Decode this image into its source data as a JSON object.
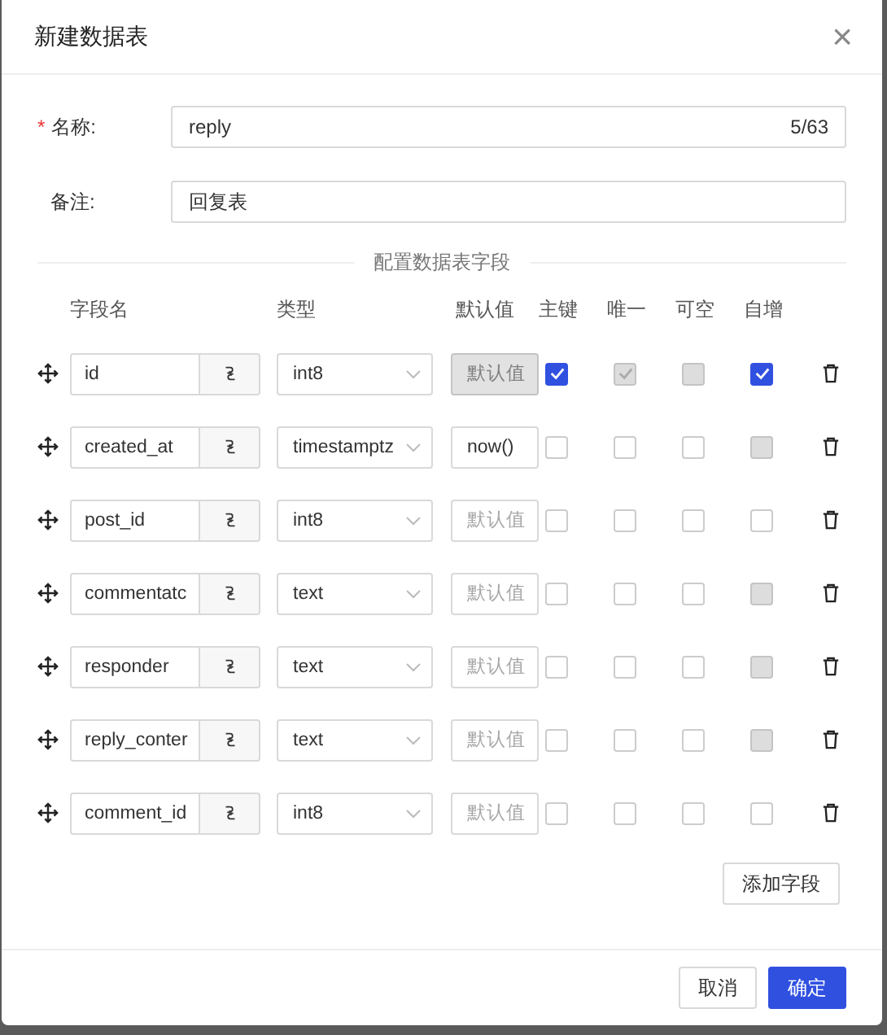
{
  "dialog": {
    "title": "新建数据表",
    "close": "×"
  },
  "form": {
    "name": {
      "label": "名称:",
      "required_mark": "*",
      "value": "reply",
      "counter": "5/63"
    },
    "remark": {
      "label": "备注:",
      "value": "回复表"
    }
  },
  "section_title": "配置数据表字段",
  "columns": [
    "字段名",
    "类型",
    "默认值",
    "主键",
    "唯一",
    "可空",
    "自增"
  ],
  "fields": [
    {
      "name": "id",
      "type": "int8",
      "default": {
        "placeholder": "默认值",
        "disabled": true
      },
      "flags": [
        {
          "checked": true,
          "disabled": false
        },
        {
          "checked": true,
          "disabled": true
        },
        {
          "checked": false,
          "disabled": true
        },
        {
          "checked": true,
          "disabled": false
        }
      ]
    },
    {
      "name": "created_at",
      "type": "timestamptz",
      "default": {
        "value": "now()",
        "disabled": false
      },
      "flags": [
        {
          "checked": false,
          "disabled": false
        },
        {
          "checked": false,
          "disabled": false
        },
        {
          "checked": false,
          "disabled": false
        },
        {
          "checked": false,
          "disabled": true
        }
      ]
    },
    {
      "name": "post_id",
      "type": "int8",
      "default": {
        "placeholder": "默认值",
        "disabled": false
      },
      "flags": [
        {
          "checked": false,
          "disabled": false
        },
        {
          "checked": false,
          "disabled": false
        },
        {
          "checked": false,
          "disabled": false
        },
        {
          "checked": false,
          "disabled": false
        }
      ]
    },
    {
      "name": "commentatc",
      "type": "text",
      "default": {
        "placeholder": "默认值",
        "disabled": false
      },
      "flags": [
        {
          "checked": false,
          "disabled": false
        },
        {
          "checked": false,
          "disabled": false
        },
        {
          "checked": false,
          "disabled": false
        },
        {
          "checked": false,
          "disabled": true
        }
      ]
    },
    {
      "name": "responder",
      "type": "text",
      "default": {
        "placeholder": "默认值",
        "disabled": false
      },
      "flags": [
        {
          "checked": false,
          "disabled": false
        },
        {
          "checked": false,
          "disabled": false
        },
        {
          "checked": false,
          "disabled": false
        },
        {
          "checked": false,
          "disabled": true
        }
      ]
    },
    {
      "name": "reply_conter",
      "type": "text",
      "default": {
        "placeholder": "默认值",
        "disabled": false
      },
      "flags": [
        {
          "checked": false,
          "disabled": false
        },
        {
          "checked": false,
          "disabled": false
        },
        {
          "checked": false,
          "disabled": false
        },
        {
          "checked": false,
          "disabled": true
        }
      ]
    },
    {
      "name": "comment_id",
      "type": "int8",
      "default": {
        "placeholder": "默认值",
        "disabled": false
      },
      "flags": [
        {
          "checked": false,
          "disabled": false
        },
        {
          "checked": false,
          "disabled": false
        },
        {
          "checked": false,
          "disabled": false
        },
        {
          "checked": false,
          "disabled": false
        }
      ]
    }
  ],
  "add_button": "添加字段",
  "buttons": [
    {
      "label": "取消",
      "kind": "secondary"
    },
    {
      "label": "确定",
      "kind": "primary"
    }
  ]
}
